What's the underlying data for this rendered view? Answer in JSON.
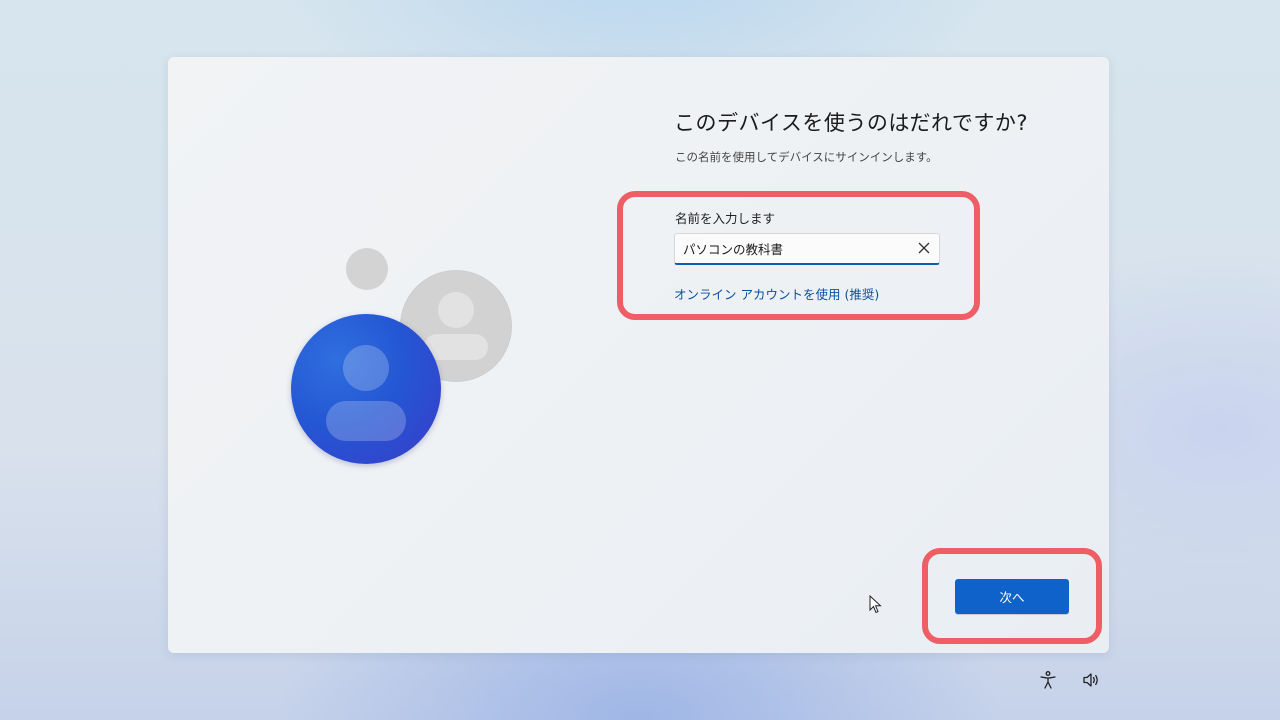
{
  "setup": {
    "title": "このデバイスを使うのはだれですか?",
    "subtitle": "この名前を使用してデバイスにサインインします。",
    "name_label": "名前を入力します",
    "name_value": "パソコンの教科書",
    "online_account_link": "オンライン アカウントを使用 (推奨)",
    "next_label": "次へ"
  },
  "icons": {
    "clear": "close-icon",
    "accessibility": "accessibility-icon",
    "volume": "volume-icon",
    "cursor": "mouse-cursor"
  },
  "colors": {
    "accent": "#0f62c9",
    "link": "#0a4f9e",
    "highlight": "#ef5d65",
    "avatar_blue": "#2457d3",
    "avatar_gray": "#d2d2d2"
  }
}
